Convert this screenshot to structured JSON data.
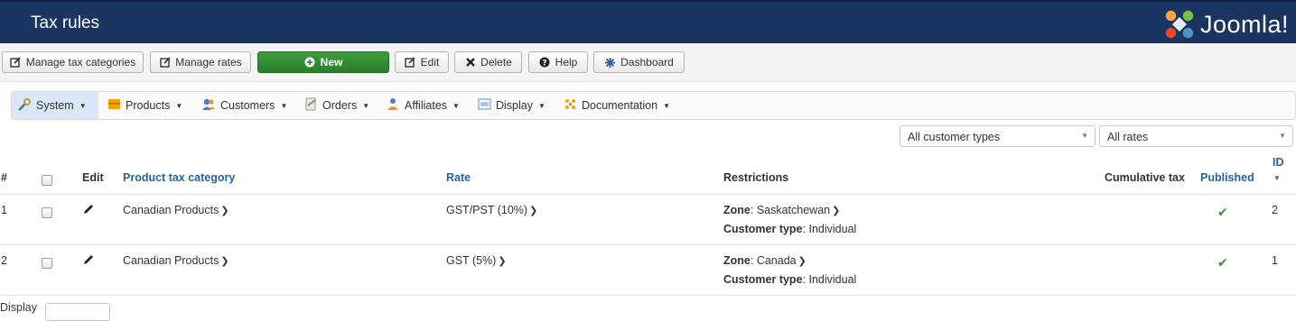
{
  "header": {
    "title": "Tax rules",
    "logo_text": "Joomla!"
  },
  "toolbar": {
    "manage_categories": "Manage tax categories",
    "manage_rates": "Manage rates",
    "new": "New",
    "edit": "Edit",
    "delete": "Delete",
    "help": "Help",
    "dashboard": "Dashboard"
  },
  "menu": {
    "system": "System",
    "products": "Products",
    "customers": "Customers",
    "orders": "Orders",
    "affiliates": "Affiliates",
    "display": "Display",
    "documentation": "Documentation"
  },
  "filters": {
    "customer_type": "All customer types",
    "rates": "All rates"
  },
  "table": {
    "headers": {
      "num": "#",
      "edit": "Edit",
      "category": "Product tax category",
      "rate": "Rate",
      "restrictions": "Restrictions",
      "cumulative": "Cumulative tax",
      "published": "Published",
      "id": "ID"
    },
    "zone_label": "Zone",
    "customer_type_label": "Customer type",
    "rows": [
      {
        "num": "1",
        "category": "Canadian Products",
        "rate": "GST/PST (10%)",
        "zone": "Saskatchewan",
        "customer_type": "Individual",
        "published": true,
        "id": "2"
      },
      {
        "num": "2",
        "category": "Canadian Products",
        "rate": "GST (5%)",
        "zone": "Canada",
        "customer_type": "Individual",
        "published": true,
        "id": "1"
      }
    ]
  },
  "footer": {
    "display_label": "Display"
  },
  "colors": {
    "header_bg": "#1b3563",
    "link": "#2a6496",
    "new_button": "#2f8a2f",
    "published_check": "#3c8b3c"
  }
}
